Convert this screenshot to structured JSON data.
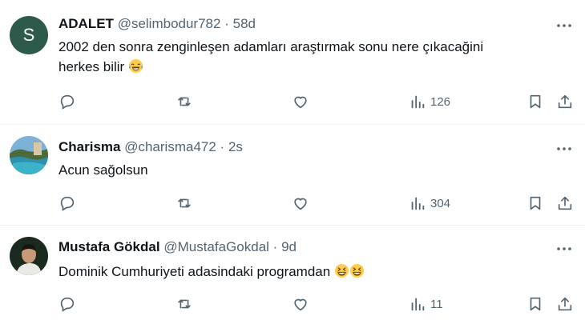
{
  "replies": [
    {
      "name": "ADALET",
      "handle": "@selimbodur782",
      "separator": "·",
      "time": "58d",
      "avatar_letter": "S",
      "text_line1": "2002 den sonra zenginleşen adamları araştırmak sonu nere çıkacağini",
      "text_line2": "herkes bilir",
      "views": "126"
    },
    {
      "name": "Charisma",
      "handle": "@charisma472",
      "separator": "·",
      "time": "2s",
      "text_line1": "Acun sağolsun",
      "views": "304"
    },
    {
      "name": "Mustafa Gökdal",
      "handle": "@MustafaGokdal",
      "separator": "·",
      "time": "9d",
      "text_line1": "Dominik Cumhuriyeti adasindaki programdan",
      "views": "11"
    }
  ],
  "icons": {
    "reply": "reply-icon",
    "retweet": "retweet-icon",
    "like": "like-icon",
    "views": "views-icon",
    "bookmark": "bookmark-icon",
    "share": "share-icon",
    "more": "more-icon",
    "emoji_laugh_tears": "face-with-tears-of-joy-icon",
    "emoji_grin": "grinning-squinting-face-icon"
  },
  "colors": {
    "text": "#0f1419",
    "secondary": "#536471",
    "divider": "#eff3f4",
    "avatar_bg": "#2d5a4a"
  }
}
